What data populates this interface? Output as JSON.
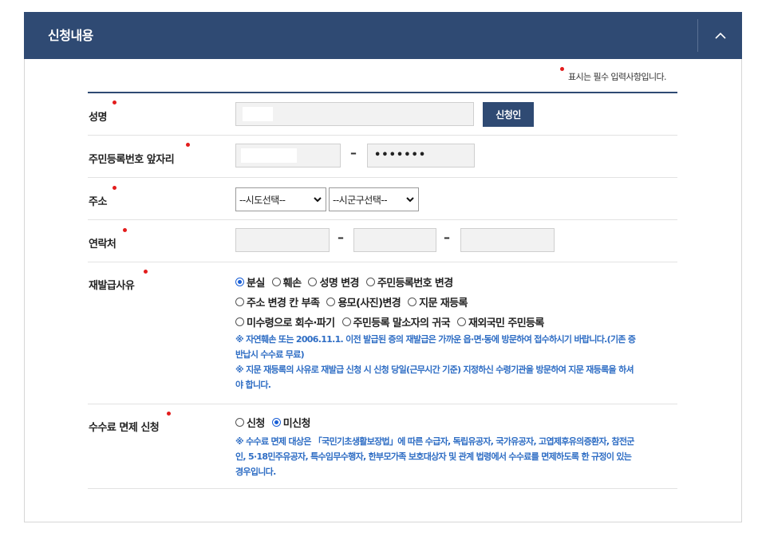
{
  "section": {
    "title": "신청내용"
  },
  "required_note": "표시는 필수 입력사항입니다.",
  "fields": {
    "name": {
      "label": "성명",
      "apply_button": "신청인"
    },
    "rrn": {
      "label": "주민등록번호 앞자리",
      "masked_value": "•••••••"
    },
    "address": {
      "label": "주소",
      "province_select": "--시도선택--",
      "city_select": "--시군구선택--"
    },
    "phone": {
      "label": "연락처"
    },
    "reason": {
      "label": "재발급사유",
      "options_row1": [
        "분실",
        "훼손",
        "성명 변경",
        "주민등록번호 변경"
      ],
      "options_row2": [
        "주소 변경 칸 부족",
        "용모(사진)변경",
        "지문 재등록"
      ],
      "options_row3": [
        "미수령으로 회수·파기",
        "주민등록 말소자의 귀국",
        "재외국민 주민등록"
      ],
      "selected": "분실",
      "notice1a": "※ 자연훼손 또는 2006.11.1. 이전 발급된 증의 재발급은 가까운 읍·면·동에 방문하여 접수하시기 바랍니다.(기존 증",
      "notice1b": "반납시 수수료 무료)",
      "notice2a": "※ 지문 재등록의 사유로 재발급 신청 시 신청 당일(근무시간 기준) 지정하신 수령기관을 방문하여 지문 재등록을 하셔",
      "notice2b": "야 합니다."
    },
    "fee_exemption": {
      "label": "수수료 면제 신청",
      "options": [
        "신청",
        "미신청"
      ],
      "selected": "미신청",
      "notice_a": "※ 수수료 면제 대상은 「국민기초생활보장법」에 따른 수급자, 독립유공자, 국가유공자, 고엽제후유의증환자, 참전군",
      "notice_b": "인, 5·18민주유공자, 특수임무수행자, 한부모가족 보호대상자 및 관계 법령에서 수수료를 면제하도록 한 규정이 있는",
      "notice_c": "경우입니다."
    }
  },
  "colors": {
    "header": "#2f4a73",
    "required_dot": "#e31c1c",
    "notice_text": "#2e6dc4",
    "radio_selected": "#1a5fd6"
  },
  "icons": {
    "collapse": "chevron-up-icon",
    "select_arrow": "chevron-down-icon"
  }
}
